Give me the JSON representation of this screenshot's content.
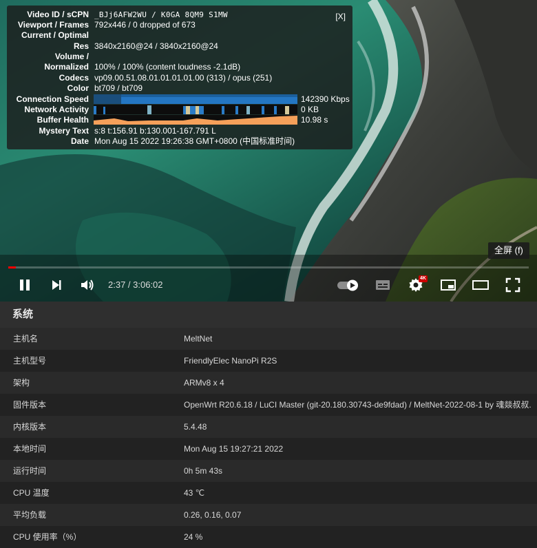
{
  "stats": {
    "close_label": "[X]",
    "rows": [
      {
        "label": "Video ID / sCPN",
        "value": "_BJj6AFW2WU / K0GA 8QM9 S1MW"
      },
      {
        "label": "Viewport / Frames",
        "value": "792x446 / 0 dropped of 673"
      },
      {
        "label": "Current / Optimal",
        "value": ""
      },
      {
        "label": "Res",
        "value": "3840x2160@24 / 3840x2160@24"
      },
      {
        "label": "Volume /",
        "value": ""
      },
      {
        "label": "Normalized",
        "value": "100% / 100% (content loudness -2.1dB)"
      },
      {
        "label": "Codecs",
        "value": "vp09.00.51.08.01.01.01.01.00 (313) / opus (251)"
      },
      {
        "label": "Color",
        "value": "bt709 / bt709"
      },
      {
        "label": "Connection Speed",
        "value": "142390 Kbps"
      },
      {
        "label": "Network Activity",
        "value": "0 KB"
      },
      {
        "label": "Buffer Health",
        "value": "10.98 s"
      },
      {
        "label": "Mystery Text",
        "value": "s:8 t:156.91 b:130.001-167.791 L"
      },
      {
        "label": "Date",
        "value": "Mon Aug 15 2022 19:26:38 GMT+0800 (中国标准时间)"
      }
    ]
  },
  "player": {
    "tooltip": "全屏 (f)",
    "time": "2:37 / 3:06:02",
    "quality_badge": "4K",
    "progress": 0.014
  },
  "system": {
    "title": "系统",
    "rows": [
      {
        "key": "主机名",
        "value": "MeltNet"
      },
      {
        "key": "主机型号",
        "value": "FriendlyElec NanoPi R2S"
      },
      {
        "key": "架构",
        "value": "ARMv8 x 4"
      },
      {
        "key": "固件版本",
        "value": "OpenWrt R20.6.18 / LuCI Master (git-20.180.30743-de9fdad) / MeltNet-2022-08-1 by 魂燚叔叔."
      },
      {
        "key": "内核版本",
        "value": "5.4.48"
      },
      {
        "key": "本地时间",
        "value": "Mon Aug 15 19:27:21 2022"
      },
      {
        "key": "运行时间",
        "value": "0h 5m 43s"
      },
      {
        "key": "CPU 温度",
        "value": "43 ℃"
      },
      {
        "key": "平均负载",
        "value": "0.26, 0.16, 0.07"
      },
      {
        "key": "CPU 使用率（%）",
        "value": "24 %"
      }
    ]
  }
}
